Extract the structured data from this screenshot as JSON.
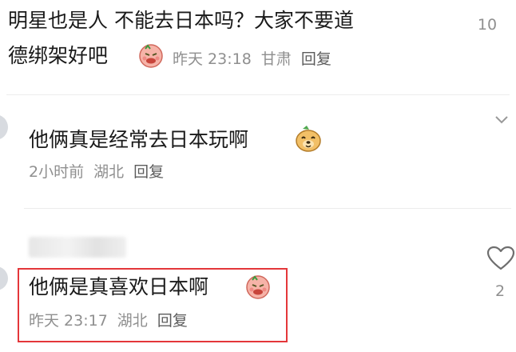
{
  "comments": [
    {
      "text_line1": "明星也是人 不能去日本吗？大家不要道",
      "text_line2": "德绑架好吧",
      "emoji": "angry-face-emoji",
      "time": "昨天 23:18",
      "location": "甘肃",
      "reply_label": "回复",
      "like_count": "10"
    },
    {
      "text": "他俩真是经常去日本玩啊",
      "emoji": "smiling-dog-emoji",
      "time": "2小时前",
      "location": "湖北",
      "reply_label": "回复"
    },
    {
      "text": "他俩是真喜欢日本啊",
      "emoji": "angry-face-emoji",
      "time": "昨天 23:17",
      "location": "湖北",
      "reply_label": "回复",
      "like_count": "2"
    }
  ],
  "colors": {
    "highlight": "#e4373a",
    "meta_text": "#8f8f8f",
    "reply_text": "#5c5c5c"
  }
}
